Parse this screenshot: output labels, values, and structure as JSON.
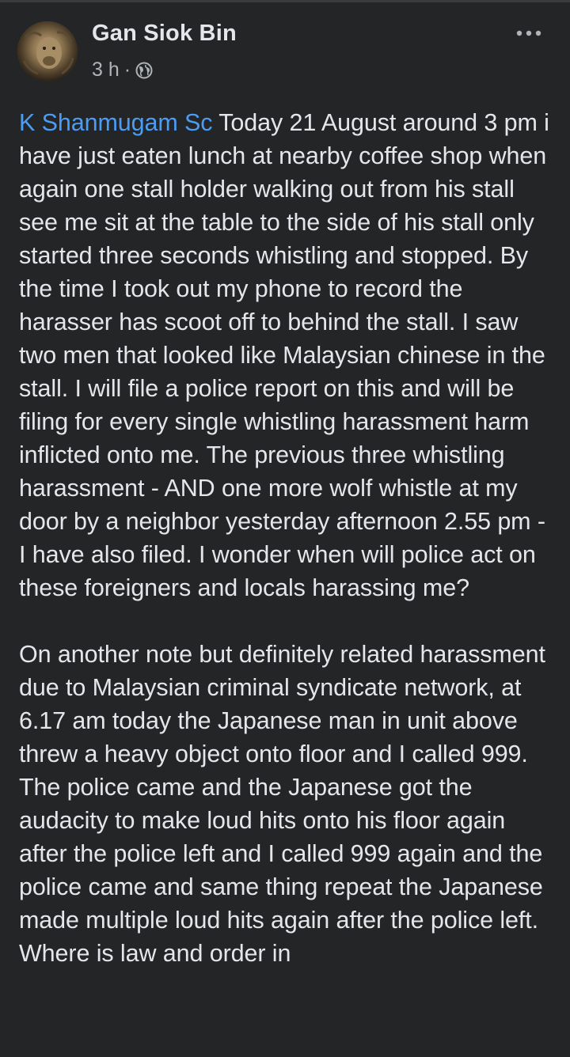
{
  "post": {
    "author": "Gan Siok Bin",
    "time": "3 h",
    "separator": "·",
    "privacy_icon": "globe-icon",
    "more_icon": "more-options-icon",
    "mention": "K Shanmugam Sc",
    "paragraph1_rest": " Today 21 August around 3 pm i have just eaten lunch at nearby coffee shop when again one stall holder walking out from his stall see me sit at the table to the side of his stall only started three seconds whistling and stopped. By the time I took out my phone to record the harasser has scoot off to behind the stall. I saw two men that looked like Malaysian chinese in the stall. I will file a police report on this and will be filing for every single whistling harassment harm inflicted onto me. The previous three whistling harassment - AND one more wolf whistle at my door by a neighbor yesterday afternoon 2.55 pm - I have also filed. I wonder when will police act on these foreigners and locals harassing me?",
    "paragraph2": "On another note but definitely related harassment due to Malaysian criminal syndicate network, at 6.17 am today the Japanese man in unit above threw a heavy object onto floor and I called 999. The police came and the Japanese got the audacity to make loud hits onto his floor again after the police left and I called 999 again and the police came and same thing repeat the Japanese made multiple loud hits again after the police left. Where is law and order in"
  },
  "colors": {
    "background": "#242526",
    "text": "#e4e6eb",
    "secondary_text": "#b0b3b8",
    "mention": "#4b9cf5"
  }
}
